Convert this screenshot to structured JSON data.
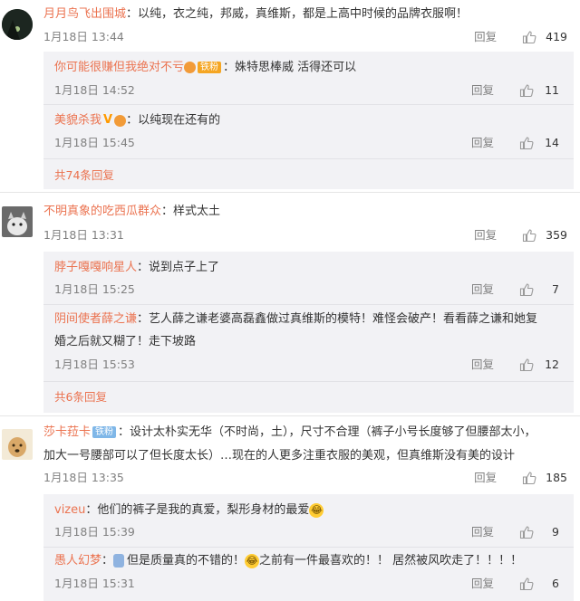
{
  "ui": {
    "reply_label": "回复",
    "accent": "#eb7350"
  },
  "comments": [
    {
      "user": "月月鸟飞出围城",
      "text": "：以纯，衣之纯，邦威，真维斯，都是上高中时候的品牌衣服啊！",
      "time": "1月18日 13:44",
      "likes": "419",
      "avatar_icon": "tree-silhouette-avatar",
      "replies": [
        {
          "user": "你可能很赚但我绝对不亏",
          "badge": "铁粉",
          "text": "：姝特思棒威 活得还可以",
          "time": "1月18日 14:52",
          "likes": "11"
        },
        {
          "user": "美貌杀我",
          "vip": "V",
          "text": "：以纯现在还有的",
          "time": "1月18日 15:45",
          "likes": "14"
        }
      ],
      "more": "共74条回复"
    },
    {
      "user": "不明真象的吃西瓜群众",
      "text": "：样式太土",
      "time": "1月18日 13:31",
      "likes": "359",
      "avatar_icon": "cat-avatar",
      "replies": [
        {
          "user": "脖子嘎嘎响星人",
          "text": "：说到点子上了",
          "time": "1月18日 15:25",
          "likes": "7"
        },
        {
          "user": "阴间使者薛之谦",
          "text": "：艺人薛之谦老婆高磊鑫做过真维斯的模特！难怪会破产！看看薛之谦和她复",
          "text2": "婚之后就又糊了！走下坡路",
          "time": "1月18日 15:53",
          "likes": "12"
        }
      ],
      "more": "共6条回复"
    },
    {
      "user": "莎卡菈卡",
      "badge": "铁粉",
      "text": "：设计太朴实无华（不时尚，土），尺寸不合理（裤子小号长度够了但腰部太小，",
      "text2": "加大一号腰部可以了但长度太长）…现在的人更多注重衣服的美观，但真维斯没有美的设计",
      "time": "1月18日 13:35",
      "likes": "185",
      "avatar_icon": "dog-avatar",
      "replies": [
        {
          "user": "vizeu",
          "text": "：他们的裤子是我的真爱，梨形身材的最爱",
          "emoji": "😂",
          "time": "1月18日 15:39",
          "likes": "9"
        },
        {
          "user": "愚人幻梦",
          "text_a": "：",
          "text_b": "但是质量真的不错的！",
          "text_c": "之前有一件最喜欢的！！ 居然被风吹走了！！！！",
          "emoji": "😂",
          "time": "1月18日 15:31",
          "likes": "6"
        }
      ]
    }
  ]
}
